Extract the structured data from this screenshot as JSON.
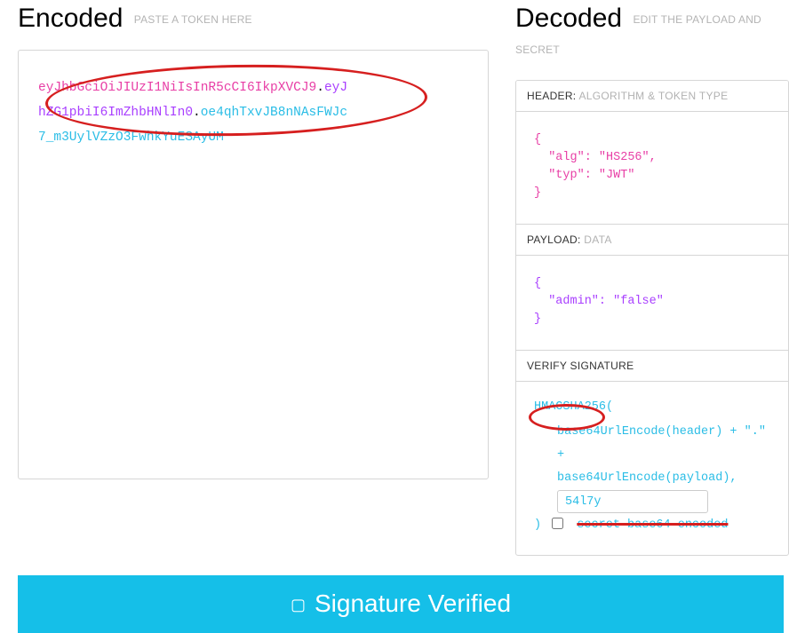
{
  "encoded": {
    "title": "Encoded",
    "subtitle": "PASTE A TOKEN HERE",
    "token_line1_header": "eyJhbGciOiJIUzI1NiIsInR5cCI6IkpXVCJ9",
    "dot1": ".",
    "token_line1_payload_tail": "eyJ",
    "token_line2_payload": "hZG1pbiI6ImZhbHNlIn0",
    "dot2": ".",
    "token_line2_sig_tail": "oe4qhTxvJB8nNAsFWJc",
    "token_line3_sig": "7_m3UylVZzO3FwhkYuESAyUM"
  },
  "decoded": {
    "title": "Decoded",
    "subtitle": "EDIT THE PAYLOAD AND SECRET",
    "header_section_label": "HEADER:",
    "header_section_sub": "ALGORITHM & TOKEN TYPE",
    "payload_section_label": "PAYLOAD:",
    "payload_section_sub": "DATA",
    "verify_section_label": "VERIFY SIGNATURE",
    "header_json": "{\n  \"alg\": \"HS256\",\n  \"typ\": \"JWT\"\n}",
    "payload_json": "{\n  \"admin\": \"false\"\n}",
    "sig": {
      "l1": "HMACSHA256(",
      "l2": "base64UrlEncode(header) + \".\" +",
      "l3": "base64UrlEncode(payload),",
      "secret_value": "54l7y",
      "l5_close": ") ",
      "l5_label": "secret base64 encoded"
    }
  },
  "footer": {
    "verify_text": "Signature Verified"
  }
}
